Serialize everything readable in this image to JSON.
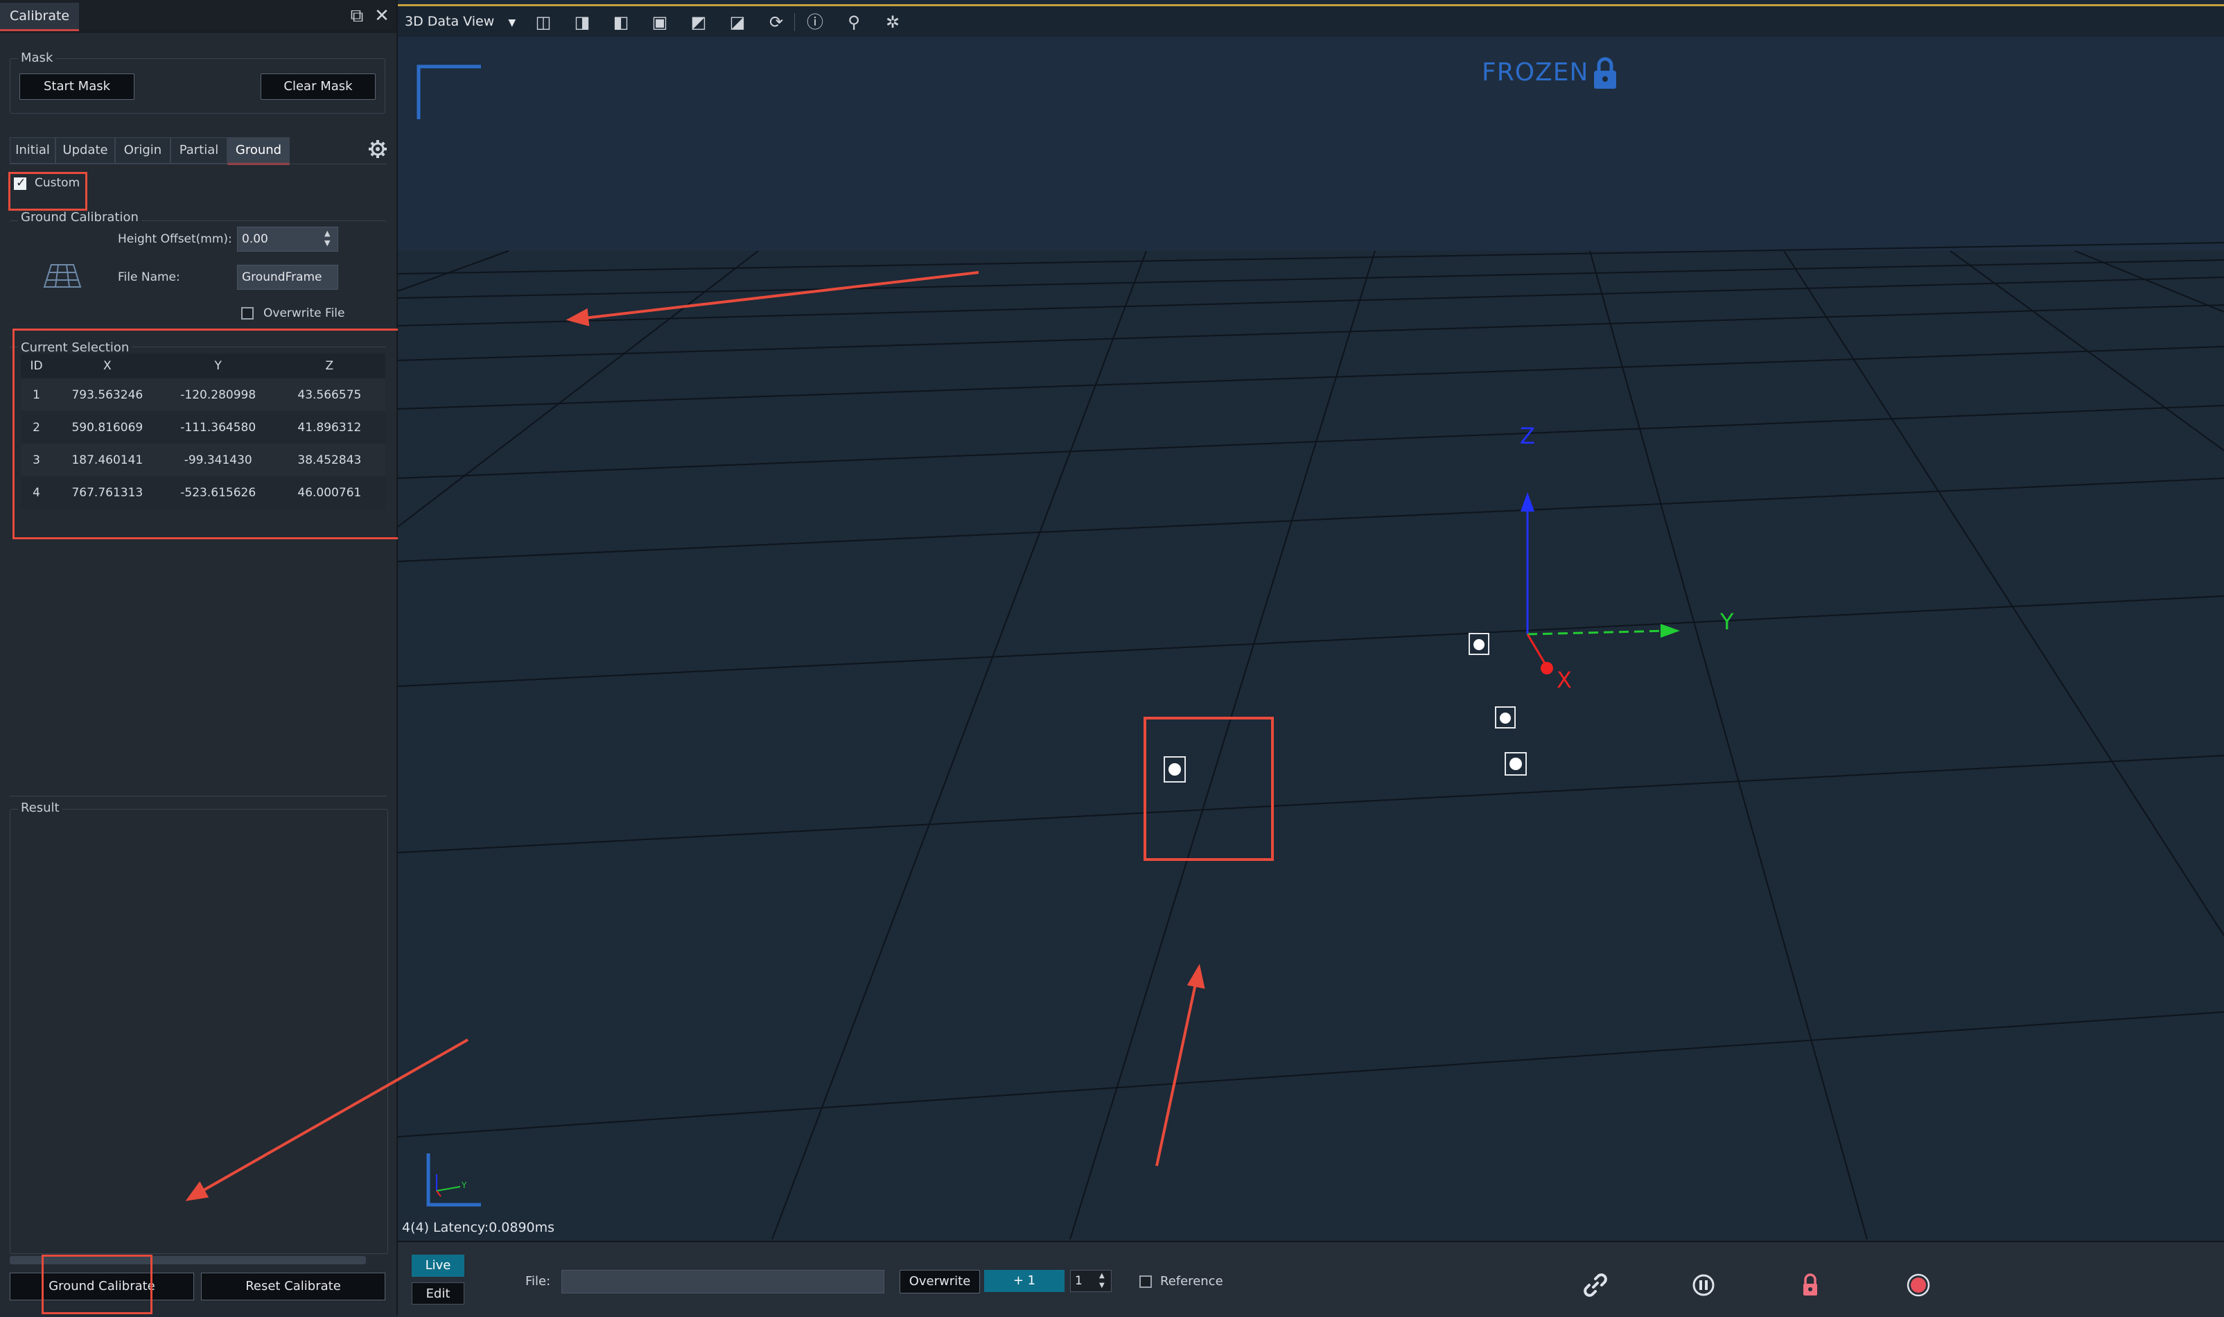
{
  "panel": {
    "tab_title": "Calibrate",
    "mask": {
      "title": "Mask",
      "start_label": "Start Mask",
      "clear_label": "Clear Mask"
    },
    "tabs": [
      "Initial",
      "Update",
      "Origin",
      "Partial",
      "Ground"
    ],
    "active_tab": "Ground",
    "custom": {
      "label": "Custom",
      "checked": true
    },
    "ground_calibration": {
      "title": "Ground Calibration",
      "height_offset_label": "Height Offset(mm):",
      "height_offset_value": "0.00",
      "file_name_label": "File Name:",
      "file_name_value": "GroundFrame",
      "overwrite_label": "Overwrite File",
      "overwrite_checked": false
    },
    "current_selection": {
      "title": "Current Selection",
      "columns": [
        "ID",
        "X",
        "Y",
        "Z"
      ],
      "rows": [
        [
          "1",
          "793.563246",
          "-120.280998",
          "43.566575"
        ],
        [
          "2",
          "590.816069",
          "-111.364580",
          "41.896312"
        ],
        [
          "3",
          "187.460141",
          "-99.341430",
          "38.452843"
        ],
        [
          "4",
          "767.761313",
          "-523.615626",
          "46.000761"
        ]
      ]
    },
    "result": {
      "title": "Result"
    },
    "ground_calibrate_label": "Ground Calibrate",
    "reset_calibrate_label": "Reset Calibrate"
  },
  "viewport": {
    "view_name": "3D Data View",
    "frozen_label": "FROZEN",
    "latency_text": "4(4) Latency:0.0890ms",
    "axes": {
      "z": "Z",
      "y": "Y",
      "x": "X"
    },
    "mini_axes": {
      "y": "Y"
    },
    "colors": {
      "z_axis": "#2233ff",
      "y_axis": "#22cc33",
      "x_axis": "#ee2222",
      "frozen": "#2c6cc8",
      "annotation": "#e84b3c"
    }
  },
  "bottom_bar": {
    "live_label": "Live",
    "edit_label": "Edit",
    "file_label": "File:",
    "file_value": "",
    "overwrite_label": "Overwrite",
    "increment_label": "+ 1",
    "step_value": "1",
    "reference_label": "Reference",
    "reference_checked": false,
    "icons": [
      "link-icon",
      "pause-icon",
      "lock-icon",
      "record-icon"
    ]
  }
}
